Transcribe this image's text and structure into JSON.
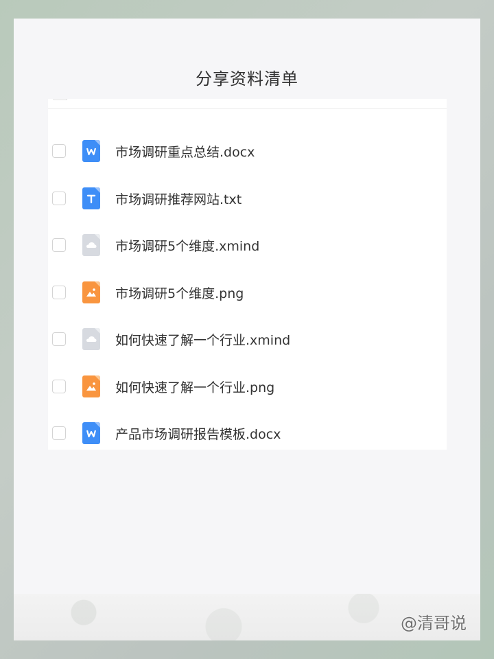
{
  "page": {
    "title": "分享资料清单",
    "watermark": "@清哥说"
  },
  "files": [
    {
      "name": "市场调研重点总结.docx",
      "type": "word-icon"
    },
    {
      "name": "市场调研推荐网站.txt",
      "type": "txt-icon"
    },
    {
      "name": "市场调研5个维度.xmind",
      "type": "xmind-icon"
    },
    {
      "name": "市场调研5个维度.png",
      "type": "image-icon"
    },
    {
      "name": "如何快速了解一个行业.xmind",
      "type": "xmind-icon"
    },
    {
      "name": "如何快速了解一个行业.png",
      "type": "image-icon"
    },
    {
      "name": "产品市场调研报告模板.docx",
      "type": "word-icon"
    }
  ],
  "colors": {
    "word": "#3e8ef7",
    "xmind": "#d7dae0",
    "image": "#f9953f",
    "card": "#f6f6f8"
  }
}
